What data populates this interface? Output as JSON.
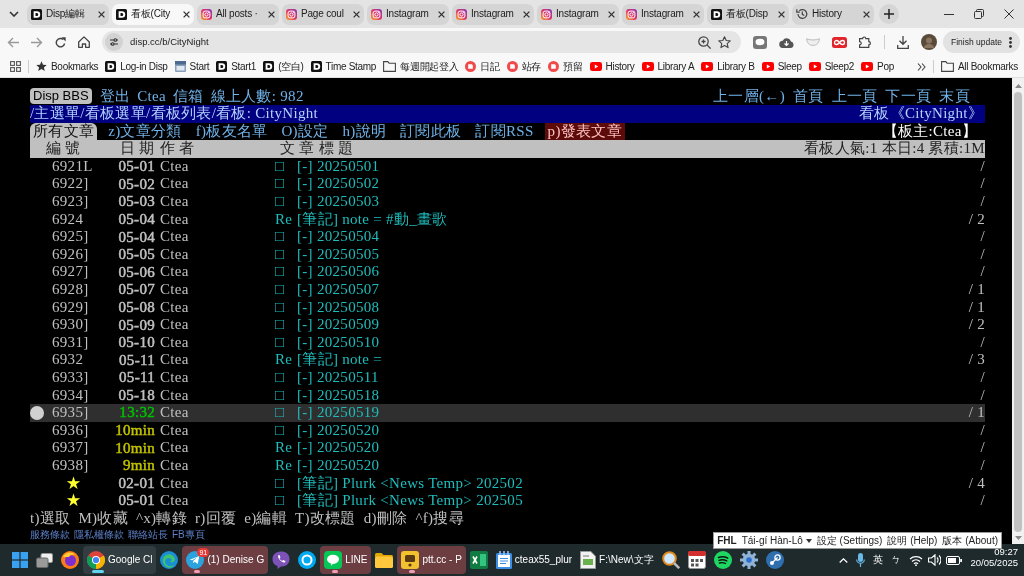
{
  "browser": {
    "tabs": [
      {
        "title": "Disp編輯",
        "kind": "logo",
        "selected": false
      },
      {
        "title": "看板(City",
        "kind": "logo",
        "selected": true
      },
      {
        "title": "All posts ·",
        "kind": "camera",
        "selected": false
      },
      {
        "title": "Page coul",
        "kind": "camera",
        "selected": false
      },
      {
        "title": "Instagram",
        "kind": "camera",
        "selected": false
      },
      {
        "title": "Instagram",
        "kind": "camera",
        "selected": false
      },
      {
        "title": "Instagram",
        "kind": "camera",
        "selected": false
      },
      {
        "title": "Instagram",
        "kind": "camera",
        "selected": false
      },
      {
        "title": "看板(Disp",
        "kind": "logo",
        "selected": false
      },
      {
        "title": "History",
        "kind": "history",
        "selected": false
      }
    ],
    "address": {
      "url": "disp.cc/b/CityNight"
    },
    "update_button": "Finish update",
    "bookmarks": [
      {
        "label": "Bookmarks",
        "kind": "star"
      },
      {
        "label": "Log-in Disp",
        "kind": "logo"
      },
      {
        "label": "Start",
        "kind": "calendar"
      },
      {
        "label": "Start1",
        "kind": "logo"
      },
      {
        "label": "(空白)",
        "kind": "logo"
      },
      {
        "label": "Time Stamp",
        "kind": "logo"
      },
      {
        "label": "每週開起登入",
        "kind": "folder"
      },
      {
        "label": "日記",
        "kind": "app"
      },
      {
        "label": "站存",
        "kind": "app"
      },
      {
        "label": "預留",
        "kind": "app"
      },
      {
        "label": "History",
        "kind": "play"
      },
      {
        "label": "Library A",
        "kind": "play"
      },
      {
        "label": "Library B",
        "kind": "play"
      },
      {
        "label": "Sleep",
        "kind": "play"
      },
      {
        "label": "Sleep2",
        "kind": "play"
      },
      {
        "label": "Pop",
        "kind": "play"
      }
    ],
    "all_bookmarks": "All Bookmarks"
  },
  "bbs": {
    "site_badge": "Disp BBS",
    "header_links": [
      "登出",
      "Ctea",
      "信箱",
      "線上人數: 982"
    ],
    "nav_links": [
      "上一層(←)",
      "首頁",
      "上一頁",
      "下一頁",
      "末頁"
    ],
    "path": "/主選單/看板選單/看板列表/看板: CityNight",
    "board_title": "看板《CityNight》",
    "menu": [
      {
        "label": "所有文章",
        "kind": "link",
        "selected": true
      },
      {
        "label": "z)文章分類",
        "kind": "link",
        "selected": false
      },
      {
        "label": "f)板友名單",
        "kind": "link",
        "selected": false
      },
      {
        "label": "O)設定",
        "kind": "link",
        "selected": false
      },
      {
        "label": "h)說明",
        "kind": "link",
        "selected": false
      },
      {
        "label": "訂閱此板",
        "kind": "link",
        "selected": false
      },
      {
        "label": "訂閱RSS",
        "kind": "link",
        "selected": false
      },
      {
        "label": "p)發表文章",
        "kind": "post",
        "selected": false
      }
    ],
    "moderator": "【板主:Ctea】",
    "columns": [
      "編 號",
      "日 期",
      "作 者",
      "文 章 標 題"
    ],
    "stats": "看板人氣:1 本日:4 累積:1M",
    "rows": [
      {
        "number": "6921L",
        "kind": "post",
        "date": {
          "text": "05-01",
          "color": "#c0c0c0"
        },
        "author": "Ctea",
        "prefix": "□",
        "title": "[-] 20250501",
        "count": "/",
        "selected": false
      },
      {
        "number": "6922]",
        "kind": "post",
        "date": {
          "text": "05-02",
          "color": "#c0c0c0"
        },
        "author": "Ctea",
        "prefix": "□",
        "title": "[-] 20250502",
        "count": "/",
        "selected": false
      },
      {
        "number": "6923]",
        "kind": "post",
        "date": {
          "text": "05-03",
          "color": "#c0c0c0"
        },
        "author": "Ctea",
        "prefix": "□",
        "title": "[-] 20250503",
        "count": "/",
        "selected": false
      },
      {
        "number": "6924",
        "kind": "post",
        "date": {
          "text": "05-04",
          "color": "#c0c0c0"
        },
        "author": "Ctea",
        "prefix": "Re",
        "title": "[筆記] note = #動_畫歌",
        "count": "/ 2",
        "selected": false
      },
      {
        "number": "6925]",
        "kind": "post",
        "date": {
          "text": "05-04",
          "color": "#c0c0c0"
        },
        "author": "Ctea",
        "prefix": "□",
        "title": "[-] 20250504",
        "count": "/",
        "selected": false
      },
      {
        "number": "6926]",
        "kind": "post",
        "date": {
          "text": "05-05",
          "color": "#c0c0c0"
        },
        "author": "Ctea",
        "prefix": "□",
        "title": "[-] 20250505",
        "count": "/",
        "selected": false
      },
      {
        "number": "6927]",
        "kind": "post",
        "date": {
          "text": "05-06",
          "color": "#c0c0c0"
        },
        "author": "Ctea",
        "prefix": "□",
        "title": "[-] 20250506",
        "count": "/",
        "selected": false
      },
      {
        "number": "6928]",
        "kind": "post",
        "date": {
          "text": "05-07",
          "color": "#c0c0c0"
        },
        "author": "Ctea",
        "prefix": "□",
        "title": "[-] 20250507",
        "count": "/ 1",
        "selected": false
      },
      {
        "number": "6929]",
        "kind": "post",
        "date": {
          "text": "05-08",
          "color": "#c0c0c0"
        },
        "author": "Ctea",
        "prefix": "□",
        "title": "[-] 20250508",
        "count": "/ 1",
        "selected": false
      },
      {
        "number": "6930]",
        "kind": "post",
        "date": {
          "text": "05-09",
          "color": "#c0c0c0"
        },
        "author": "Ctea",
        "prefix": "□",
        "title": "[-] 20250509",
        "count": "/ 2",
        "selected": false
      },
      {
        "number": "6931]",
        "kind": "post",
        "date": {
          "text": "05-10",
          "color": "#c0c0c0"
        },
        "author": "Ctea",
        "prefix": "□",
        "title": "[-] 20250510",
        "count": "/",
        "selected": false
      },
      {
        "number": "6932",
        "kind": "post",
        "date": {
          "text": "05-11",
          "color": "#c0c0c0"
        },
        "author": "Ctea",
        "prefix": "Re",
        "title": "[筆記] note =",
        "count": "/ 3",
        "selected": false
      },
      {
        "number": "6933]",
        "kind": "post",
        "date": {
          "text": "05-11",
          "color": "#c0c0c0"
        },
        "author": "Ctea",
        "prefix": "□",
        "title": "[-] 20250511",
        "count": "/",
        "selected": false
      },
      {
        "number": "6934]",
        "kind": "post",
        "date": {
          "text": "05-18",
          "color": "#c0c0c0"
        },
        "author": "Ctea",
        "prefix": "□",
        "title": "[-] 20250518",
        "count": "/",
        "selected": false
      },
      {
        "number": "6935]",
        "kind": "post",
        "date": {
          "text": "13:32",
          "color": "#00c000"
        },
        "author": "Ctea",
        "prefix": "□",
        "title": "[-] 20250519",
        "count": "/ 1",
        "selected": true
      },
      {
        "number": "6936]",
        "kind": "post",
        "date": {
          "text": "10min",
          "color": "#c0c000"
        },
        "author": "Ctea",
        "prefix": "□",
        "title": "[-] 20250520",
        "count": "/",
        "selected": false
      },
      {
        "number": "6937]",
        "kind": "post",
        "date": {
          "text": "10min",
          "color": "#c0c000"
        },
        "author": "Ctea",
        "prefix": "Re",
        "title": "[-] 20250520",
        "count": "/",
        "selected": false
      },
      {
        "number": "6938]",
        "kind": "post",
        "date": {
          "text": "9min",
          "color": "#c0c000"
        },
        "author": "Ctea",
        "prefix": "Re",
        "title": "[-] 20250520",
        "count": "/",
        "selected": false
      },
      {
        "number": "★",
        "kind": "pinned",
        "date": {
          "text": "02-01",
          "color": "#c0c0c0"
        },
        "author": "Ctea",
        "prefix": "□",
        "title": "[筆記] Plurk <News Temp> 202502",
        "count": "/ 4",
        "selected": false
      },
      {
        "number": "★",
        "kind": "pinned",
        "date": {
          "text": "05-01",
          "color": "#c0c0c0"
        },
        "author": "Ctea",
        "prefix": "□",
        "title": "[筆記] Plurk <News Temp> 202505",
        "count": "/",
        "selected": false
      }
    ],
    "commands": [
      "t)選取",
      "M)收藏",
      "^x)轉錄",
      "r)回覆",
      "e)編輯",
      "T)改標題",
      "d)刪除",
      "^f)搜尋"
    ],
    "footer_links": [
      "服務條款",
      "隱私權條款",
      "聯絡站長",
      "FB專頁"
    ]
  },
  "taskbar": {
    "apps": [
      {
        "kind": "start",
        "selected": false,
        "flashing": false
      },
      {
        "kind": "task_view",
        "selected": false,
        "flashing": false
      },
      {
        "kind": "fox",
        "selected": false,
        "flashing": false
      },
      {
        "kind": "chrome",
        "label": "Google Cl",
        "selected": true,
        "flashing": false
      },
      {
        "kind": "edge",
        "selected": false,
        "flashing": false
      },
      {
        "kind": "plane",
        "label": "(1) Denise G",
        "badge": "91",
        "selected": false,
        "flashing": true
      },
      {
        "kind": "viber",
        "selected": false,
        "flashing": false
      },
      {
        "kind": "skype",
        "selected": false,
        "flashing": false
      },
      {
        "kind": "chat",
        "label": "LINE",
        "selected": false,
        "flashing": true
      },
      {
        "kind": "folder",
        "selected": false,
        "flashing": false
      },
      {
        "kind": "ptt",
        "label": "ptt.cc - P",
        "selected": false,
        "flashing": true
      },
      {
        "kind": "sheet",
        "selected": false,
        "flashing": false
      },
      {
        "kind": "notepad",
        "label": "cteax55_plur",
        "selected": false,
        "flashing": false
      },
      {
        "kind": "document",
        "label": "F:\\New\\文字",
        "selected": false,
        "flashing": false
      },
      {
        "kind": "magnifier",
        "selected": false,
        "flashing": false
      },
      {
        "kind": "calendar",
        "selected": false,
        "flashing": false
      },
      {
        "kind": "music",
        "selected": false,
        "flashing": false
      },
      {
        "kind": "gear",
        "selected": false,
        "flashing": false
      },
      {
        "kind": "game",
        "selected": false,
        "flashing": false
      }
    ],
    "language_bar": [
      {
        "label": "FHL",
        "kind": "brand"
      },
      {
        "label": "Tái-gí Hàn-Lô",
        "kind": "dropdown"
      },
      {
        "label": "設定 (Settings)",
        "kind": "link"
      },
      {
        "label": "說明 (Help)",
        "kind": "link"
      },
      {
        "label": "版本 (About)",
        "kind": "link"
      }
    ],
    "input_indicators": [
      "英",
      "ㄅ"
    ],
    "clock": {
      "time": "09:27",
      "date": "20/05/2025"
    }
  }
}
